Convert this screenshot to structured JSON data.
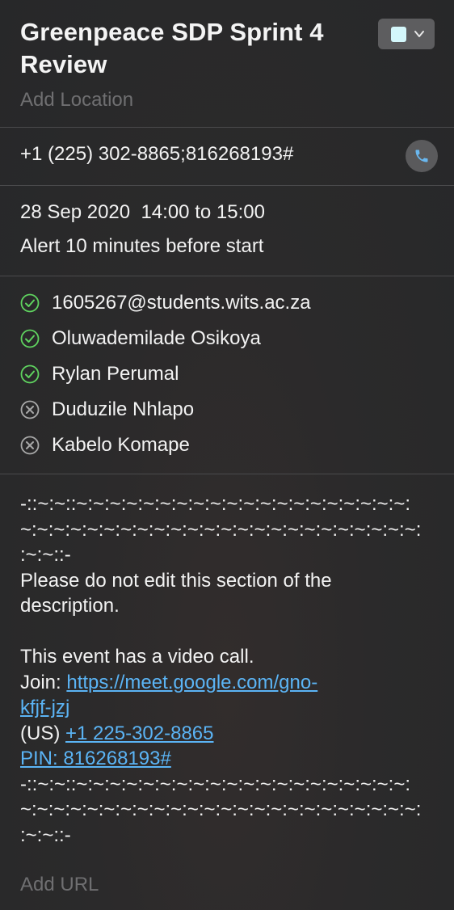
{
  "event": {
    "title_line1": "Greenpeace SDP Sprint 4",
    "title_line2": "Review",
    "location_placeholder": "Add Location",
    "calendar_color": "#d4f7fb"
  },
  "phone": {
    "number": "+1 (225) 302-8865;816268193#",
    "call_icon": "phone-icon"
  },
  "schedule": {
    "date_time": "28 Sep 2020  14:00 to 15:00",
    "alert": "Alert 10 minutes before start"
  },
  "attendees": [
    {
      "name": "1605267@students.wits.ac.za",
      "status": "accepted"
    },
    {
      "name": "Oluwademilade Osikoya",
      "status": "accepted"
    },
    {
      "name": "Rylan Perumal",
      "status": "accepted"
    },
    {
      "name": "Duduzile Nhlapo",
      "status": "declined"
    },
    {
      "name": "Kabelo Komape",
      "status": "declined"
    }
  ],
  "description": {
    "sep1": "-::~:~::~:~:~:~:~:~:~:~:~:~:~:~:~:~:~:~:~:~:~:~:",
    "sep2": "~:~:~:~:~:~:~:~:~:~:~:~:~:~:~:~:~:~:~:~:~:~:~:~:",
    "sep3": ":~:~::-",
    "notice1": "Please do not edit this section of the",
    "notice2": "description.",
    "video_call": "This event has a video call.",
    "join_label": "Join: ",
    "join_link1": "https://meet.google.com/gno-",
    "join_link2": "kfjf-jzj",
    "us_label": "(US) ",
    "us_phone": "+1 225-302-8865",
    "pin": "PIN: 816268193#",
    "sep4": "-::~:~::~:~:~:~:~:~:~:~:~:~:~:~:~:~:~:~:~:~:~:~:",
    "sep5": "~:~:~:~:~:~:~:~:~:~:~:~:~:~:~:~:~:~:~:~:~:~:~:~:",
    "sep6": ":~:~::-"
  },
  "url_placeholder": "Add URL",
  "colors": {
    "accepted": "#5fd35f",
    "declined": "#a8a8a8",
    "link": "#5bb4f5"
  }
}
